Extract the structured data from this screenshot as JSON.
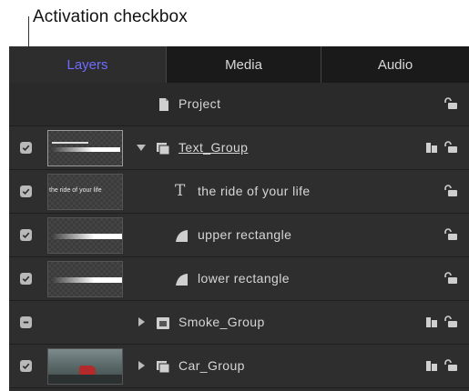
{
  "callout": {
    "label": "Activation checkbox"
  },
  "tabs": [
    {
      "label": "Layers",
      "active": true
    },
    {
      "label": "Media",
      "active": false
    },
    {
      "label": "Audio",
      "active": false
    }
  ],
  "accent_color": "#6f6cff",
  "rows": [
    {
      "name": "Project",
      "type": "project",
      "checkbox": "none",
      "icon": "document-icon"
    },
    {
      "name": "Text_Group",
      "type": "group",
      "checkbox": "checked",
      "expanded": true,
      "icon": "group-icon"
    },
    {
      "name": "the ride of your life",
      "type": "text",
      "checkbox": "checked",
      "icon": "text-icon",
      "thumb_text": "the ride of your life"
    },
    {
      "name": "upper rectangle",
      "type": "shape",
      "checkbox": "checked",
      "icon": "shape-icon"
    },
    {
      "name": "lower rectangle",
      "type": "shape",
      "checkbox": "checked",
      "icon": "shape-icon"
    },
    {
      "name": "Smoke_Group",
      "type": "group",
      "checkbox": "mixed",
      "expanded": false,
      "icon": "group-icon"
    },
    {
      "name": "Car_Group",
      "type": "group",
      "checkbox": "checked",
      "expanded": false,
      "icon": "group-icon"
    }
  ]
}
